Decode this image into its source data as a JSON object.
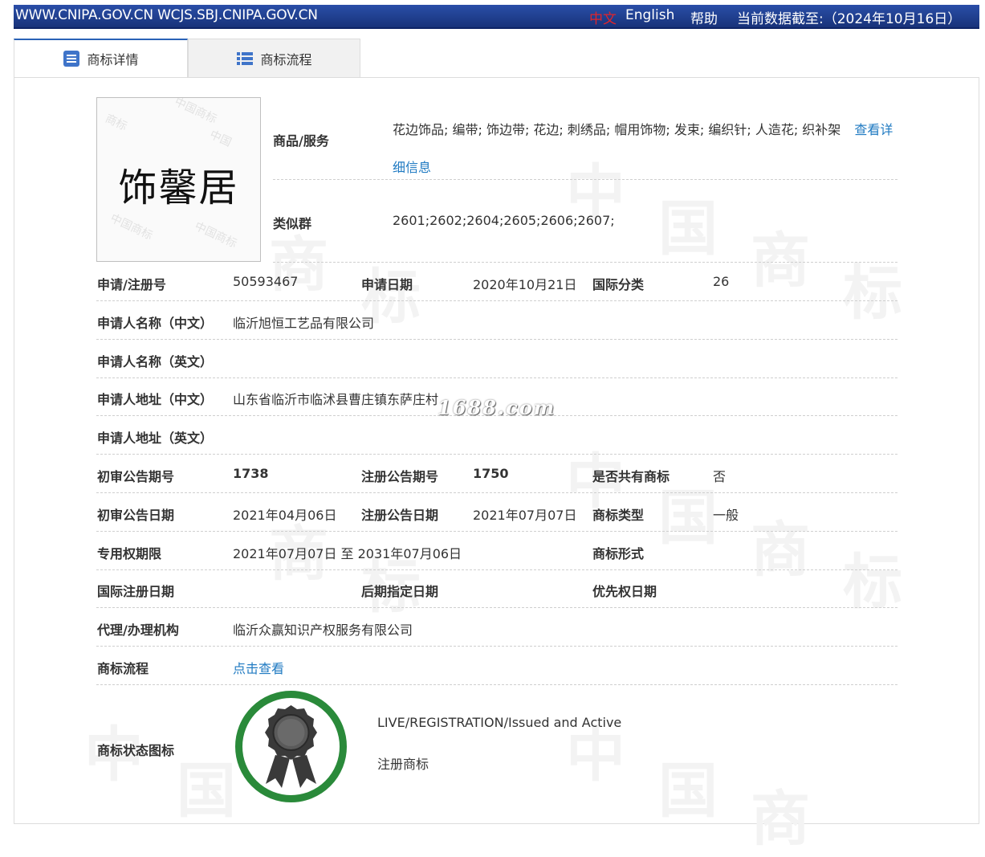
{
  "topbar": {
    "domains": "WWW.CNIPA.GOV.CN WCJS.SBJ.CNIPA.GOV.CN",
    "lang_zh": "中文",
    "lang_en": "English",
    "help": "帮助",
    "data_date": "当前数据截至:（2024年10月16日）"
  },
  "tabs": [
    {
      "label": "商标详情",
      "icon": "list-doc-icon",
      "active": true
    },
    {
      "label": "商标流程",
      "icon": "list-bullets-icon",
      "active": false
    }
  ],
  "trademark": {
    "image_text": "饰馨居",
    "goods_label": "商品/服务",
    "goods_value": "花边饰品; 编带; 饰边带; 花边; 刺绣品; 帽用饰物; 发束; 编织针; 人造花; 织补架",
    "goods_link": "查看详细信息",
    "similar_label": "类似群",
    "similar_value": "2601;2602;2604;2605;2606;2607;"
  },
  "fields": {
    "reg_no_label": "申请/注册号",
    "reg_no": "50593467",
    "apply_date_label": "申请日期",
    "apply_date": "2020年10月21日",
    "intl_class_label": "国际分类",
    "intl_class": "26",
    "applicant_cn_label": "申请人名称（中文）",
    "applicant_cn": "临沂旭恒工艺品有限公司",
    "applicant_en_label": "申请人名称（英文）",
    "applicant_en": "",
    "address_cn_label": "申请人地址（中文）",
    "address_cn": "山东省临沂市临沭县曹庄镇东萨庄村",
    "address_en_label": "申请人地址（英文）",
    "address_en": "",
    "prelim_no_label": "初审公告期号",
    "prelim_no": "1738",
    "reg_pub_no_label": "注册公告期号",
    "reg_pub_no": "1750",
    "shared_label": "是否共有商标",
    "shared": "否",
    "prelim_date_label": "初审公告日期",
    "prelim_date": "2021年04月06日",
    "reg_pub_date_label": "注册公告日期",
    "reg_pub_date": "2021年07月07日",
    "tm_type_label": "商标类型",
    "tm_type": "一般",
    "exclusive_label": "专用权期限",
    "exclusive": "2021年07月07日 至 2031年07月06日",
    "tm_form_label": "商标形式",
    "tm_form": "",
    "intl_reg_date_label": "国际注册日期",
    "later_date_label": "后期指定日期",
    "priority_date_label": "优先权日期",
    "agent_label": "代理/办理机构",
    "agent": "临沂众赢知识产权服务有限公司",
    "flow_label": "商标流程",
    "flow_link": "点击查看",
    "status_icon_label": "商标状态图标",
    "status_en": "LIVE/REGISTRATION/Issued and Active",
    "status_cn": "注册商标"
  },
  "watermark_site": "1688.com",
  "colors": {
    "topbar": "#1d3c8c",
    "link": "#1f7ac2",
    "badge_ring": "#2a8a3a",
    "badge_seal": "#3a3a3a"
  }
}
